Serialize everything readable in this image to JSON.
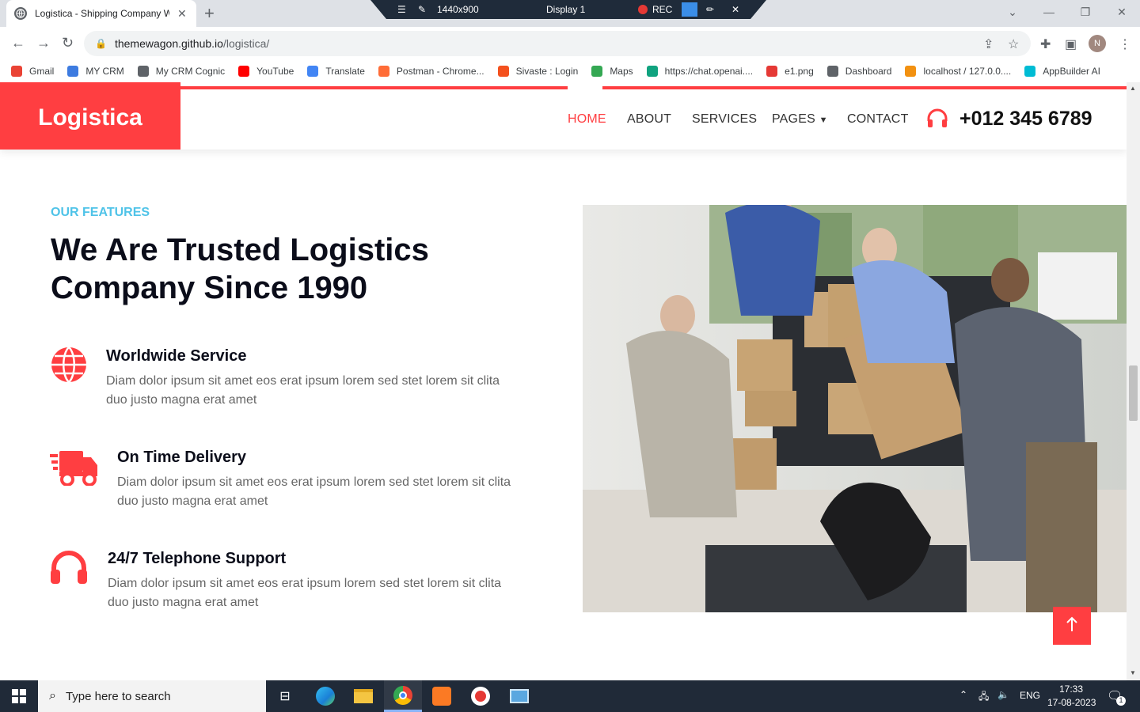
{
  "browser": {
    "tab_title": "Logistica - Shipping Company W",
    "new_tab": "+",
    "url_host": "themewagon.github.io",
    "url_path": "/logistica/",
    "profile_initial": "N",
    "recorder": {
      "resolution": "1440x900",
      "display": "Display 1",
      "rec_label": "REC"
    },
    "bookmarks": [
      {
        "label": "Gmail",
        "color": "#ea4335"
      },
      {
        "label": "MY CRM",
        "color": "#3d7be0"
      },
      {
        "label": "My CRM Cognic",
        "color": "#5f6368"
      },
      {
        "label": "YouTube",
        "color": "#ff0000"
      },
      {
        "label": "Translate",
        "color": "#4285f4"
      },
      {
        "label": "Postman - Chrome...",
        "color": "#ff6c37"
      },
      {
        "label": "Sivaste : Login",
        "color": "#f4511e"
      },
      {
        "label": "Maps",
        "color": "#34a853"
      },
      {
        "label": "https://chat.openai....",
        "color": "#10a37f"
      },
      {
        "label": "e1.png",
        "color": "#e53935"
      },
      {
        "label": "Dashboard",
        "color": "#5f6368"
      },
      {
        "label": "localhost / 127.0.0....",
        "color": "#f29111"
      },
      {
        "label": "AppBuilder AI",
        "color": "#00bcd4"
      }
    ]
  },
  "site": {
    "brand": "Logistica",
    "nav": [
      "HOME",
      "ABOUT",
      "SERVICES",
      "PAGES",
      "CONTACT"
    ],
    "phone": "+012 345 6789",
    "accent": "#ff3e41",
    "subtitle": "OUR FEATURES",
    "heading_line1": "We Are Trusted Logistics",
    "heading_line2": "Company Since 1990",
    "features": [
      {
        "title": "Worldwide Service",
        "icon": "globe-icon",
        "desc_line1": "Diam dolor ipsum sit amet eos erat ipsum lorem sed stet lorem sit clita",
        "desc_line2": "duo justo magna erat amet"
      },
      {
        "title": "On Time Delivery",
        "icon": "truck-icon",
        "desc_line1": "Diam dolor ipsum sit amet eos erat ipsum lorem sed stet lorem sit clita",
        "desc_line2": "duo justo magna erat amet"
      },
      {
        "title": "24/7 Telephone Support",
        "icon": "headphones-icon",
        "desc_line1": "Diam dolor ipsum sit amet eos erat ipsum lorem sed stet lorem sit clita",
        "desc_line2": "duo justo magna erat amet"
      }
    ]
  },
  "taskbar": {
    "search_placeholder": "Type here to search",
    "language": "ENG",
    "time": "17:33",
    "date": "17-08-2023",
    "notification_count": "1"
  }
}
